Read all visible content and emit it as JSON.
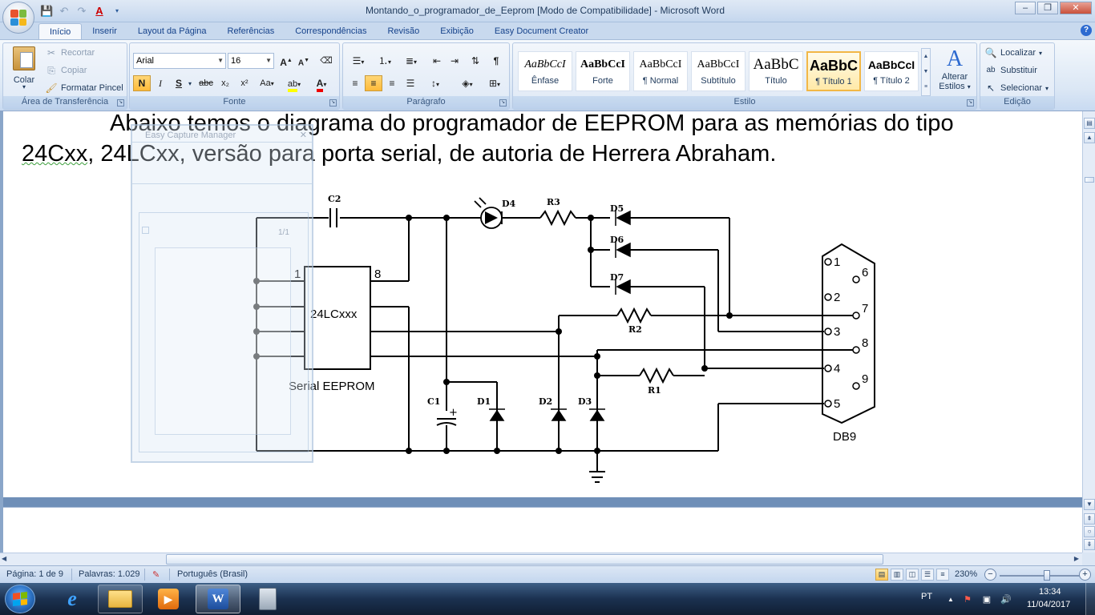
{
  "window": {
    "title": "Montando_o_programador_de_Eeprom [Modo de Compatibilidade] - Microsoft Word",
    "controls": [
      "–",
      "□",
      "✕"
    ]
  },
  "tabs": [
    "Início",
    "Inserir",
    "Layout da Página",
    "Referências",
    "Correspondências",
    "Revisão",
    "Exibição",
    "Easy Document Creator"
  ],
  "ribbon": {
    "clipboard": {
      "label": "Área de Transferência",
      "paste": "Colar",
      "cut": "Recortar",
      "copy": "Copiar",
      "format_painter": "Formatar Pincel"
    },
    "font": {
      "label": "Fonte",
      "family": "Arial",
      "size": "16",
      "bold": "N",
      "italic": "I",
      "underline": "S",
      "strike": "abc",
      "subscript": "x₂",
      "superscript": "x²",
      "change_case": "Aa",
      "grow": "A",
      "shrink": "A"
    },
    "paragraph": {
      "label": "Parágrafo",
      "show_marks": "¶"
    },
    "styles": {
      "label": "Estilo",
      "items": [
        {
          "preview": "AaBbCcI",
          "name": "Ênfase"
        },
        {
          "preview": "AaBbCcI",
          "name": "Forte"
        },
        {
          "preview": "AaBbCcI",
          "name": "¶ Normal"
        },
        {
          "preview": "AaBbCcI",
          "name": "Subtítulo"
        },
        {
          "preview": "AaBbC",
          "name": "Título"
        },
        {
          "preview": "AaBbC",
          "name": "¶ Título 1"
        },
        {
          "preview": "AaBbCcI",
          "name": "¶ Título 2"
        }
      ],
      "change_styles_line1": "Alterar",
      "change_styles_line2": "Estilos"
    },
    "editing": {
      "label": "Edição",
      "find": "Localizar",
      "replace": "Substituir",
      "select": "Selecionar"
    }
  },
  "document": {
    "line1": "Abaixo temos o diagrama do programador de EEPROM para as memórias do tipo",
    "line2_word1": "24Cxx",
    "line2_rest": ", 24LCxx, versão para porta serial, de autoria de Herrera Abraham."
  },
  "schematic": {
    "components": [
      "C2",
      "D4",
      "R3",
      "D5",
      "D6",
      "D7",
      "R2",
      "R1",
      "C1",
      "D1",
      "D2",
      "D3"
    ],
    "chip_label": "24LCxxx",
    "chip_pin1": "1",
    "chip_pin8": "8",
    "chip_caption": "Serial EEPROM",
    "db9_label": "DB9",
    "db9_pins_left": [
      "1",
      "2",
      "3",
      "4",
      "5"
    ],
    "db9_pins_right": [
      "6",
      "7",
      "8",
      "9"
    ]
  },
  "ghost_window": {
    "title": "Easy Capture Manager",
    "close": "✕",
    "counter": "1/1"
  },
  "statusbar": {
    "page": "Página: 1 de 9",
    "words": "Palavras: 1.029",
    "language": "Português (Brasil)",
    "zoom": "230%"
  },
  "taskbar": {
    "language": "PT",
    "time": "13:34",
    "date": "11/04/2017"
  },
  "colors": {
    "accent": "#2b579a",
    "ribbon_bg": "#dbe7f5",
    "taskbar": "#1b3150"
  }
}
